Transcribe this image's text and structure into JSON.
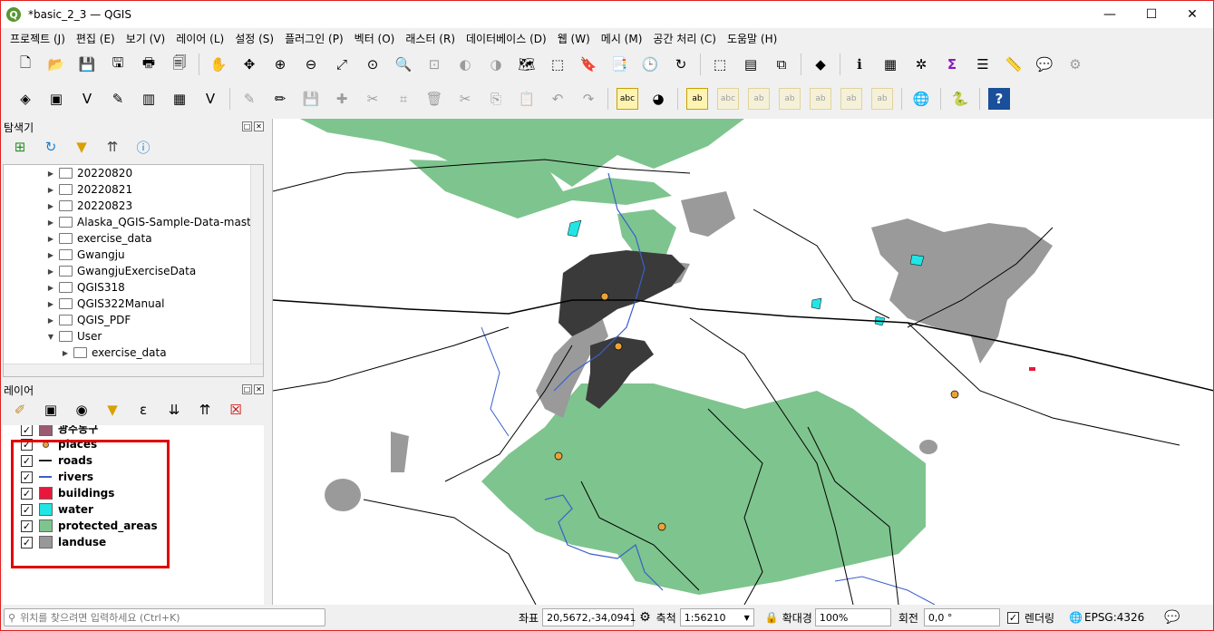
{
  "window": {
    "title": "*basic_2_3 — QGIS"
  },
  "menu": [
    "프로젝트 (J)",
    "편집 (E)",
    "보기 (V)",
    "레이어 (L)",
    "설정 (S)",
    "플러그인 (P)",
    "벡터 (O)",
    "래스터 (R)",
    "데이터베이스 (D)",
    "웹 (W)",
    "메시 (M)",
    "공간 처리 (C)",
    "도움말 (H)"
  ],
  "toolbar1": [
    "new-project-icon",
    "open-project-icon",
    "save-project-icon",
    "save-as-icon",
    "print-layout-icon",
    "layout-manager-icon",
    "pan-icon",
    "pan-to-selection-icon",
    "zoom-in-icon",
    "zoom-out-icon",
    "zoom-full-icon",
    "zoom-to-selection-icon",
    "zoom-to-layer-icon",
    "zoom-native-icon",
    "zoom-last-icon",
    "zoom-next-icon",
    "new-map-view-icon",
    "new-3d-view-icon",
    "new-bookmark-icon",
    "show-bookmarks-icon",
    "temporal-icon",
    "refresh-icon",
    "select-features-icon",
    "attribute-select-icon",
    "deselect-icon",
    "select-location-icon",
    "identify-icon",
    "attribute-table-icon",
    "field-calculator-icon",
    "statistics-icon",
    "open-table-icon",
    "measure-icon",
    "annotation-icon",
    "map-tips-icon"
  ],
  "toolbar2": [
    "add-vector-layer-icon",
    "add-raster-layer-icon",
    "add-delimited-text-icon",
    "digitize-icon",
    "add-spatialite-icon",
    "add-grid-icon",
    "identify-layer-icon",
    "current-edits-icon",
    "toggle-editing-icon",
    "save-edits-icon",
    "add-feature-icon",
    "vertex-tool-icon",
    "digitize-options-icon",
    "delete-selected-icon",
    "cut-features-icon",
    "copy-features-icon",
    "paste-features-icon",
    "undo-icon",
    "redo-icon",
    "label-tool-icon",
    "diagram-tool-icon",
    "label-layer-icon",
    "label-pin-icon",
    "label-highlight-icon",
    "label-show-hide-icon",
    "label-move-icon",
    "label-rotate-icon",
    "label-change-icon",
    "globe-icon",
    "python-console-icon",
    "help-icon"
  ],
  "browser": {
    "title": "탐색기",
    "items": [
      {
        "label": "20220820",
        "indent": 0,
        "expanded": false
      },
      {
        "label": "20220821",
        "indent": 0,
        "expanded": false
      },
      {
        "label": "20220823",
        "indent": 0,
        "expanded": false
      },
      {
        "label": "Alaska_QGIS-Sample-Data-master",
        "indent": 0,
        "expanded": false
      },
      {
        "label": "exercise_data",
        "indent": 0,
        "expanded": false
      },
      {
        "label": "Gwangju",
        "indent": 0,
        "expanded": false
      },
      {
        "label": "GwangjuExerciseData",
        "indent": 0,
        "expanded": false
      },
      {
        "label": "QGIS318",
        "indent": 0,
        "expanded": false
      },
      {
        "label": "QGIS322Manual",
        "indent": 0,
        "expanded": false
      },
      {
        "label": "QGIS_PDF",
        "indent": 0,
        "expanded": false
      },
      {
        "label": "User",
        "indent": 0,
        "expanded": true
      },
      {
        "label": "exercise_data",
        "indent": 1,
        "expanded": false
      }
    ]
  },
  "layers": {
    "title": "레이어",
    "items": [
      {
        "label": "광주동구",
        "symbol": "fill",
        "color": "#9a5a72",
        "partial": true
      },
      {
        "label": "places",
        "symbol": "point",
        "color": "#e8a23a"
      },
      {
        "label": "roads",
        "symbol": "line",
        "color": "#222222"
      },
      {
        "label": "rivers",
        "symbol": "line",
        "color": "#3a5fcd"
      },
      {
        "label": "buildings",
        "symbol": "fill",
        "color": "#e8183c"
      },
      {
        "label": "water",
        "symbol": "fill",
        "color": "#22e5e5"
      },
      {
        "label": "protected_areas",
        "symbol": "fill",
        "color": "#7ec48e"
      },
      {
        "label": "landuse",
        "symbol": "fill",
        "color": "#989898"
      }
    ]
  },
  "colors": {
    "protected": "#7ec48e",
    "landuse": "#9a9a9a",
    "water": "#22e5e5",
    "roads": "#000000",
    "rivers": "#3a5fcd",
    "places": "#e8a23a",
    "highlight": "#e00000"
  },
  "status": {
    "search_placeholder": "위치를 찾으려면 입력하세요 (Ctrl+K)",
    "coord_label": "좌표",
    "coord_value": "20,5672,-34,0941",
    "scale_label": "축척",
    "scale_value": "1:56210",
    "magnifier_label": "확대경",
    "magnifier_value": "100%",
    "rotation_label": "회전",
    "rotation_value": "0,0 °",
    "render_label": "렌더링",
    "crs": "EPSG:4326"
  }
}
